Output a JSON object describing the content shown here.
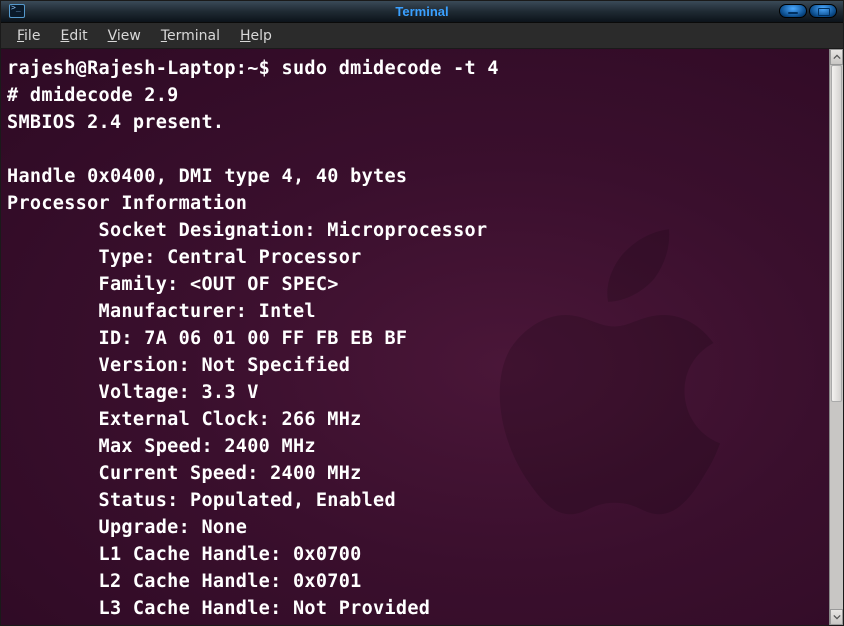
{
  "window": {
    "title": "Terminal"
  },
  "menu": {
    "file": "File",
    "edit": "Edit",
    "view": "View",
    "terminal": "Terminal",
    "help": "Help"
  },
  "terminal": {
    "prompt": "rajesh@Rajesh-Laptop:~$ ",
    "command": "sudo dmidecode -t 4",
    "lines": {
      "l1": "# dmidecode 2.9",
      "l2": "SMBIOS 2.4 present.",
      "l3": "",
      "l4": "Handle 0x0400, DMI type 4, 40 bytes",
      "l5": "Processor Information",
      "l6": "        Socket Designation: Microprocessor",
      "l7": "        Type: Central Processor",
      "l8": "        Family: <OUT OF SPEC>",
      "l9": "        Manufacturer: Intel",
      "l10": "        ID: 7A 06 01 00 FF FB EB BF",
      "l11": "        Version: Not Specified",
      "l12": "        Voltage: 3.3 V",
      "l13": "        External Clock: 266 MHz",
      "l14": "        Max Speed: 2400 MHz",
      "l15": "        Current Speed: 2400 MHz",
      "l16": "        Status: Populated, Enabled",
      "l17": "        Upgrade: None",
      "l18": "        L1 Cache Handle: 0x0700",
      "l19": "        L2 Cache Handle: 0x0701",
      "l20": "        L3 Cache Handle: Not Provided"
    }
  }
}
